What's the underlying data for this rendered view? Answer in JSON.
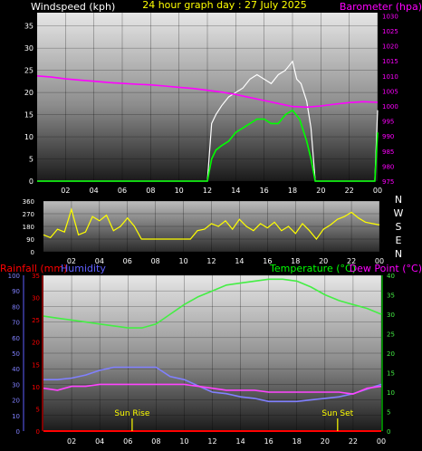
{
  "header": {
    "left_label": "Windspeed (kph)",
    "title": "24 hour graph day : 27 July 2025",
    "right_label": "Barometer (hpa)"
  },
  "panel3_header": {
    "rainfall_label": "Rainfall (mm)",
    "humidity_label": "Humidity",
    "temperature_label": "Temperature (°C)",
    "dewpoint_label": "Dew Point (°C)"
  },
  "compass_letters": [
    "N",
    "W",
    "S",
    "E",
    "N"
  ],
  "markers": {
    "sunrise_label": "Sun Rise",
    "sunset_label": "Sun Set"
  },
  "colors": {
    "wind": "#00ff00",
    "gust": "#ffffff",
    "barometer": "#ff00ff",
    "direction": "#ffff00",
    "temperature": "#44ee44",
    "dewpoint": "#ff44ff",
    "humidity": "#8080ff",
    "rainfall": "#ff0000",
    "header_white": "#ffffff",
    "header_yellow": "#ffff00",
    "header_magenta": "#ff00ff",
    "header_red": "#ff0000",
    "header_blue": "#6060ff",
    "header_green": "#00ff00"
  },
  "chart_data": [
    {
      "type": "line",
      "name": "wind",
      "x_ticks": [
        "02",
        "04",
        "06",
        "08",
        "10",
        "12",
        "14",
        "16",
        "18",
        "20",
        "22",
        "00"
      ],
      "left_axis": {
        "ticks": [
          "0",
          "5",
          "10",
          "15",
          "20",
          "25",
          "30",
          "35"
        ],
        "ylim": [
          0,
          38
        ]
      },
      "right_axis": {
        "ticks": [
          "975",
          "980",
          "985",
          "990",
          "995",
          "1000",
          "1005",
          "1010",
          "1015",
          "1020",
          "1025",
          "1030"
        ],
        "ylim": [
          975,
          1031
        ]
      },
      "barometer": {
        "x": [
          0,
          1,
          2,
          3,
          4,
          5,
          6,
          7,
          8,
          9,
          10,
          11,
          12,
          13,
          14,
          15,
          16,
          17,
          18,
          19,
          20,
          21,
          22,
          23,
          24
        ],
        "y": [
          1010,
          1009.6,
          1009,
          1008.6,
          1008.2,
          1007.8,
          1007.5,
          1007.2,
          1007,
          1006.6,
          1006.2,
          1005.8,
          1005.2,
          1004.6,
          1003.8,
          1002.8,
          1001.8,
          1000.8,
          999.8,
          999.6,
          1000,
          1000.6,
          1001.1,
          1001.4,
          1001.2
        ]
      },
      "wind_avg": {
        "x": [
          0,
          12,
          12.3,
          12.6,
          13,
          13.5,
          14,
          14.5,
          15,
          15.5,
          16,
          16.5,
          17,
          17.5,
          18,
          18.5,
          19,
          19.3,
          19.6,
          20,
          23.8,
          24
        ],
        "y": [
          0,
          0,
          5,
          7,
          8,
          9,
          11,
          12,
          13,
          14,
          14,
          13,
          13,
          15,
          16,
          14,
          9,
          5,
          0,
          0,
          0,
          11
        ]
      },
      "wind_gust": {
        "x": [
          0,
          12,
          12.3,
          12.6,
          13,
          13.5,
          14,
          14.5,
          15,
          15.5,
          16,
          16.5,
          17,
          17.5,
          18,
          18.3,
          18.6,
          19,
          19.3,
          19.6,
          20,
          23.8,
          24
        ],
        "y": [
          0,
          0,
          13,
          15,
          17,
          19,
          20,
          21,
          23,
          24,
          23,
          22,
          24,
          25,
          27,
          23,
          22,
          18,
          12,
          0,
          0,
          0,
          16
        ]
      }
    },
    {
      "type": "line",
      "name": "wind_direction",
      "x_ticks": [
        "02",
        "04",
        "06",
        "08",
        "10",
        "12",
        "14",
        "16",
        "18",
        "20",
        "22",
        "00"
      ],
      "left_axis": {
        "ticks": [
          "0",
          "90",
          "180",
          "270",
          "360"
        ],
        "ylim": [
          0,
          360
        ]
      },
      "direction": {
        "x": [
          0,
          0.5,
          1,
          1.5,
          2,
          2.5,
          3,
          3.5,
          4,
          4.5,
          5,
          5.5,
          6,
          6.5,
          7,
          7.5,
          8,
          8.5,
          9,
          9.5,
          10,
          10.5,
          11,
          11.5,
          12,
          12.5,
          13,
          13.5,
          14,
          14.5,
          15,
          15.5,
          16,
          16.5,
          17,
          17.5,
          18,
          18.5,
          19,
          19.5,
          20,
          20.5,
          21,
          21.5,
          22,
          22.5,
          23,
          23.5,
          24
        ],
        "y": [
          120,
          100,
          160,
          140,
          300,
          120,
          140,
          250,
          220,
          260,
          150,
          180,
          240,
          180,
          90,
          90,
          90,
          90,
          90,
          90,
          90,
          90,
          150,
          160,
          200,
          180,
          220,
          160,
          230,
          180,
          150,
          200,
          170,
          210,
          150,
          180,
          130,
          200,
          150,
          90,
          160,
          190,
          230,
          250,
          280,
          240,
          210,
          200,
          190
        ]
      }
    },
    {
      "type": "line",
      "name": "temperature_humidity",
      "x_ticks": [
        "02",
        "04",
        "06",
        "08",
        "10",
        "12",
        "14",
        "16",
        "18",
        "20",
        "22",
        "00"
      ],
      "humidity_axis": {
        "ticks": [
          "0",
          "10",
          "20",
          "30",
          "40",
          "50",
          "60",
          "70",
          "80",
          "90",
          "100"
        ],
        "ylim": [
          0,
          100
        ]
      },
      "rainfall_axis": {
        "ticks": [
          "0",
          "5",
          "10",
          "15",
          "20",
          "25",
          "30",
          "35"
        ],
        "ylim": [
          0,
          35
        ]
      },
      "temperature_axis": {
        "ticks": [
          "0",
          "5",
          "10",
          "15",
          "20",
          "25",
          "30",
          "35",
          "40"
        ],
        "ylim": [
          0,
          40
        ]
      },
      "temperature": {
        "x": [
          0,
          1,
          2,
          3,
          4,
          5,
          6,
          7,
          8,
          9,
          10,
          11,
          12,
          13,
          14,
          15,
          16,
          17,
          18,
          19,
          20,
          21,
          22,
          23,
          24
        ],
        "y": [
          29.5,
          29,
          28.5,
          28,
          27.5,
          27,
          26.5,
          26.5,
          27.5,
          30,
          32.5,
          34.5,
          36,
          37.5,
          38,
          38.5,
          39,
          39,
          38.5,
          37,
          35,
          33.5,
          32.5,
          31.5,
          30
        ]
      },
      "dewpoint": {
        "x": [
          0,
          1,
          2,
          3,
          4,
          5,
          6,
          7,
          8,
          9,
          10,
          11,
          12,
          13,
          14,
          15,
          16,
          17,
          18,
          19,
          20,
          21,
          22,
          23,
          24
        ],
        "y": [
          11,
          10.5,
          11.5,
          11.5,
          12,
          12,
          12,
          12,
          12,
          12,
          12,
          11.5,
          11,
          10.5,
          10.5,
          10.5,
          10,
          10,
          10,
          10,
          10,
          10,
          9.5,
          11,
          11.5
        ]
      },
      "humidity": {
        "x": [
          0,
          1,
          2,
          3,
          4,
          5,
          6,
          7,
          8,
          9,
          10,
          11,
          12,
          13,
          14,
          15,
          16,
          17,
          18,
          19,
          20,
          21,
          22,
          23,
          24
        ],
        "y": [
          33,
          33,
          34,
          36,
          39,
          41,
          41,
          41,
          41,
          35,
          33,
          29,
          25,
          24,
          22,
          21,
          19,
          19,
          19,
          20,
          21,
          22,
          24,
          27,
          30
        ]
      },
      "rainfall": {
        "x": [
          0,
          24
        ],
        "y": [
          0,
          0
        ]
      },
      "sunrise_hour": 6.3,
      "sunset_hour": 20.9
    }
  ]
}
